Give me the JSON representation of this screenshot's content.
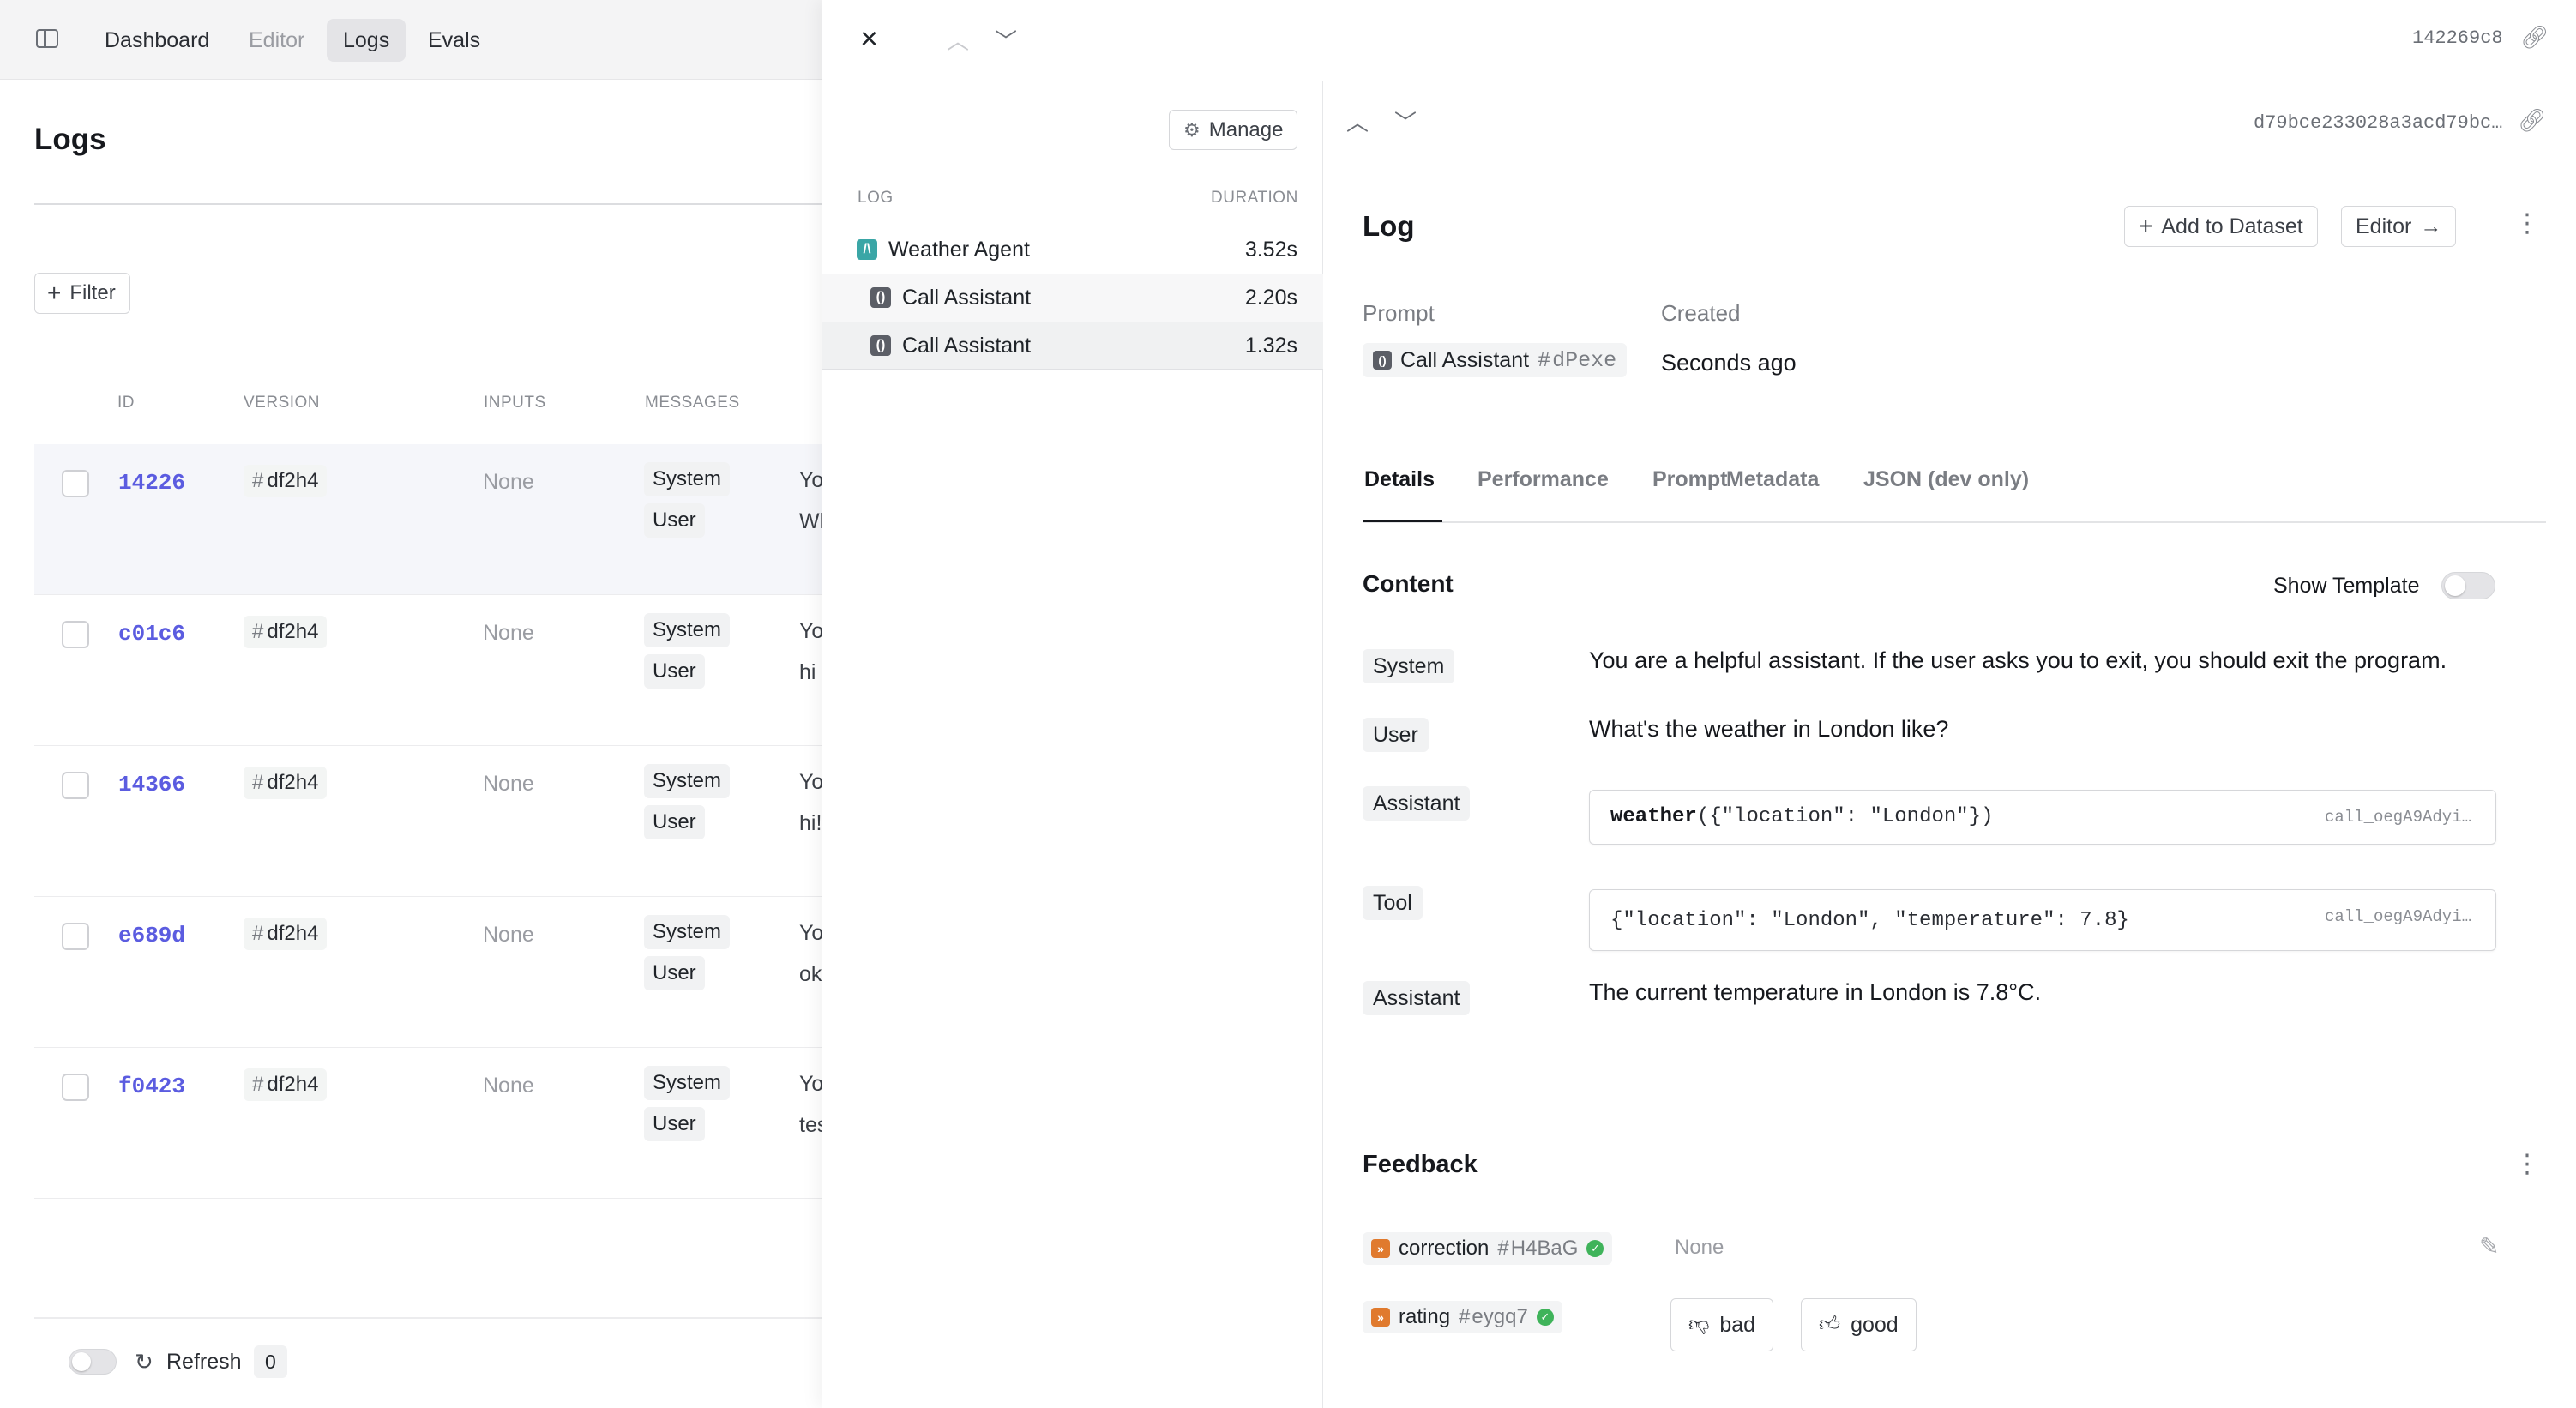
{
  "nav": {
    "tabs": [
      {
        "label": "Dashboard"
      },
      {
        "label": "Editor"
      },
      {
        "label": "Logs"
      },
      {
        "label": "Evals"
      }
    ]
  },
  "logs_page": {
    "title": "Logs",
    "filter_label": "Filter",
    "columns": {
      "id": "ID",
      "version": "VERSION",
      "inputs": "INPUTS",
      "messages": "MESSAGES"
    },
    "rows": [
      {
        "id": "14226",
        "version": "df2h4",
        "inputs": "None",
        "role1": "System",
        "msg1": "You a",
        "role2": "User",
        "msg2": "What"
      },
      {
        "id": "c01c6",
        "version": "df2h4",
        "inputs": "None",
        "role1": "System",
        "msg1": "You a",
        "role2": "User",
        "msg2": "hi"
      },
      {
        "id": "14366",
        "version": "df2h4",
        "inputs": "None",
        "role1": "System",
        "msg1": "You a",
        "role2": "User",
        "msg2": "hi!"
      },
      {
        "id": "e689d",
        "version": "df2h4",
        "inputs": "None",
        "role1": "System",
        "msg1": "You a",
        "role2": "User",
        "msg2": "ok bu"
      },
      {
        "id": "f0423",
        "version": "df2h4",
        "inputs": "None",
        "role1": "System",
        "msg1": "You a",
        "role2": "User",
        "msg2": "testin"
      }
    ],
    "refresh_label": "Refresh",
    "refresh_count": "0"
  },
  "drawer": {
    "header_id": "142269c8",
    "manage_label": "Manage",
    "trace_columns": {
      "log": "LOG",
      "duration": "DURATION"
    },
    "trace": [
      {
        "label": "Weather Agent",
        "duration": "3.52s"
      },
      {
        "label": "Call Assistant",
        "duration": "2.20s"
      },
      {
        "label": "Call Assistant",
        "duration": "1.32s"
      }
    ],
    "detail": {
      "id": "d79bce233028a3acd79bc…",
      "title": "Log",
      "add_to_dataset": "Add to Dataset",
      "editor": "Editor",
      "prompt_label": "Prompt",
      "prompt_name": "Call Assistant",
      "prompt_version": "dPexe",
      "created_label": "Created",
      "created_value": "Seconds ago",
      "tabs": [
        "Details",
        "Performance",
        "Prompt",
        "Metadata",
        "JSON (dev only)"
      ],
      "content_heading": "Content",
      "show_template": "Show Template",
      "messages": [
        {
          "role": "System",
          "text": "You are a helpful assistant. If the user asks you to exit, you should exit the program."
        },
        {
          "role": "User",
          "text": "What's the weather in London like?"
        },
        {
          "role": "Assistant",
          "fn": "weather",
          "args": "({\"location\": \"London\"})",
          "call_id": "call_oegA9Adyi…"
        },
        {
          "role": "Tool",
          "text": "{\"location\": \"London\", \"temperature\": 7.8}",
          "call_id": "call_oegA9Adyi…"
        },
        {
          "role": "Assistant",
          "text": "The current temperature in London is 7.8°C."
        }
      ],
      "feedback_heading": "Feedback",
      "feedback": [
        {
          "name": "correction",
          "version": "H4BaG",
          "value": "None"
        },
        {
          "name": "rating",
          "version": "eygq7"
        }
      ],
      "vote_bad": "bad",
      "vote_good": "good"
    }
  },
  "colors": {
    "accent_id": "#5b5ce0",
    "weather_agent_icon": "#3aa6a6",
    "evaluator_icon": "#e07a2e",
    "check_green": "#3fb35a"
  }
}
